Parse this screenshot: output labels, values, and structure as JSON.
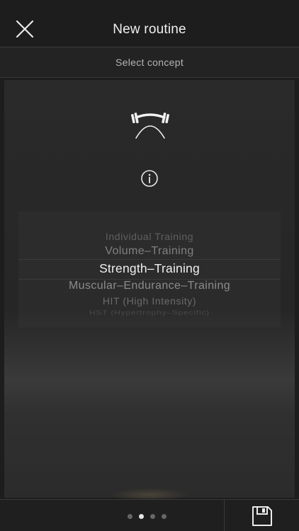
{
  "header": {
    "title": "New routine",
    "close_icon": "close-icon"
  },
  "subheader": {
    "label": "Select concept"
  },
  "concept": {
    "icon": "barbell-icon",
    "info_icon": "info-icon"
  },
  "picker": {
    "items": [
      "Individual Training",
      "Volume–Training",
      "Strength–Training",
      "Muscular–Endurance–Training",
      "HIT (High Intensity)",
      "HST (Hypertrophy–Specific)"
    ],
    "selected": "Strength–Training"
  },
  "pagination": {
    "count": 4,
    "active_page": 2
  },
  "footer": {
    "save_icon": "save-icon"
  },
  "colors": {
    "background": "#1d1d1d",
    "text": "#f0f0f0",
    "dim_text": "#808080",
    "divider": "#3a3a3a"
  }
}
